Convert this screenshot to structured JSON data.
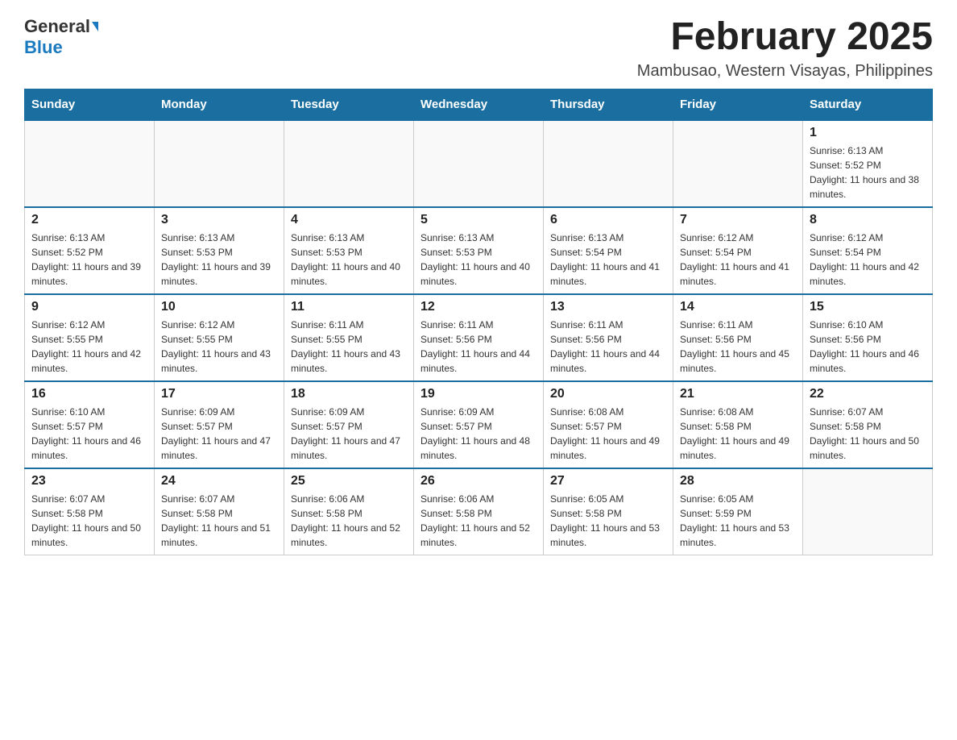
{
  "logo": {
    "general": "General",
    "blue": "Blue"
  },
  "title": "February 2025",
  "location": "Mambusao, Western Visayas, Philippines",
  "days_of_week": [
    "Sunday",
    "Monday",
    "Tuesday",
    "Wednesday",
    "Thursday",
    "Friday",
    "Saturday"
  ],
  "weeks": [
    [
      {
        "day": "",
        "info": ""
      },
      {
        "day": "",
        "info": ""
      },
      {
        "day": "",
        "info": ""
      },
      {
        "day": "",
        "info": ""
      },
      {
        "day": "",
        "info": ""
      },
      {
        "day": "",
        "info": ""
      },
      {
        "day": "1",
        "info": "Sunrise: 6:13 AM\nSunset: 5:52 PM\nDaylight: 11 hours and 38 minutes."
      }
    ],
    [
      {
        "day": "2",
        "info": "Sunrise: 6:13 AM\nSunset: 5:52 PM\nDaylight: 11 hours and 39 minutes."
      },
      {
        "day": "3",
        "info": "Sunrise: 6:13 AM\nSunset: 5:53 PM\nDaylight: 11 hours and 39 minutes."
      },
      {
        "day": "4",
        "info": "Sunrise: 6:13 AM\nSunset: 5:53 PM\nDaylight: 11 hours and 40 minutes."
      },
      {
        "day": "5",
        "info": "Sunrise: 6:13 AM\nSunset: 5:53 PM\nDaylight: 11 hours and 40 minutes."
      },
      {
        "day": "6",
        "info": "Sunrise: 6:13 AM\nSunset: 5:54 PM\nDaylight: 11 hours and 41 minutes."
      },
      {
        "day": "7",
        "info": "Sunrise: 6:12 AM\nSunset: 5:54 PM\nDaylight: 11 hours and 41 minutes."
      },
      {
        "day": "8",
        "info": "Sunrise: 6:12 AM\nSunset: 5:54 PM\nDaylight: 11 hours and 42 minutes."
      }
    ],
    [
      {
        "day": "9",
        "info": "Sunrise: 6:12 AM\nSunset: 5:55 PM\nDaylight: 11 hours and 42 minutes."
      },
      {
        "day": "10",
        "info": "Sunrise: 6:12 AM\nSunset: 5:55 PM\nDaylight: 11 hours and 43 minutes."
      },
      {
        "day": "11",
        "info": "Sunrise: 6:11 AM\nSunset: 5:55 PM\nDaylight: 11 hours and 43 minutes."
      },
      {
        "day": "12",
        "info": "Sunrise: 6:11 AM\nSunset: 5:56 PM\nDaylight: 11 hours and 44 minutes."
      },
      {
        "day": "13",
        "info": "Sunrise: 6:11 AM\nSunset: 5:56 PM\nDaylight: 11 hours and 44 minutes."
      },
      {
        "day": "14",
        "info": "Sunrise: 6:11 AM\nSunset: 5:56 PM\nDaylight: 11 hours and 45 minutes."
      },
      {
        "day": "15",
        "info": "Sunrise: 6:10 AM\nSunset: 5:56 PM\nDaylight: 11 hours and 46 minutes."
      }
    ],
    [
      {
        "day": "16",
        "info": "Sunrise: 6:10 AM\nSunset: 5:57 PM\nDaylight: 11 hours and 46 minutes."
      },
      {
        "day": "17",
        "info": "Sunrise: 6:09 AM\nSunset: 5:57 PM\nDaylight: 11 hours and 47 minutes."
      },
      {
        "day": "18",
        "info": "Sunrise: 6:09 AM\nSunset: 5:57 PM\nDaylight: 11 hours and 47 minutes."
      },
      {
        "day": "19",
        "info": "Sunrise: 6:09 AM\nSunset: 5:57 PM\nDaylight: 11 hours and 48 minutes."
      },
      {
        "day": "20",
        "info": "Sunrise: 6:08 AM\nSunset: 5:57 PM\nDaylight: 11 hours and 49 minutes."
      },
      {
        "day": "21",
        "info": "Sunrise: 6:08 AM\nSunset: 5:58 PM\nDaylight: 11 hours and 49 minutes."
      },
      {
        "day": "22",
        "info": "Sunrise: 6:07 AM\nSunset: 5:58 PM\nDaylight: 11 hours and 50 minutes."
      }
    ],
    [
      {
        "day": "23",
        "info": "Sunrise: 6:07 AM\nSunset: 5:58 PM\nDaylight: 11 hours and 50 minutes."
      },
      {
        "day": "24",
        "info": "Sunrise: 6:07 AM\nSunset: 5:58 PM\nDaylight: 11 hours and 51 minutes."
      },
      {
        "day": "25",
        "info": "Sunrise: 6:06 AM\nSunset: 5:58 PM\nDaylight: 11 hours and 52 minutes."
      },
      {
        "day": "26",
        "info": "Sunrise: 6:06 AM\nSunset: 5:58 PM\nDaylight: 11 hours and 52 minutes."
      },
      {
        "day": "27",
        "info": "Sunrise: 6:05 AM\nSunset: 5:58 PM\nDaylight: 11 hours and 53 minutes."
      },
      {
        "day": "28",
        "info": "Sunrise: 6:05 AM\nSunset: 5:59 PM\nDaylight: 11 hours and 53 minutes."
      },
      {
        "day": "",
        "info": ""
      }
    ]
  ]
}
